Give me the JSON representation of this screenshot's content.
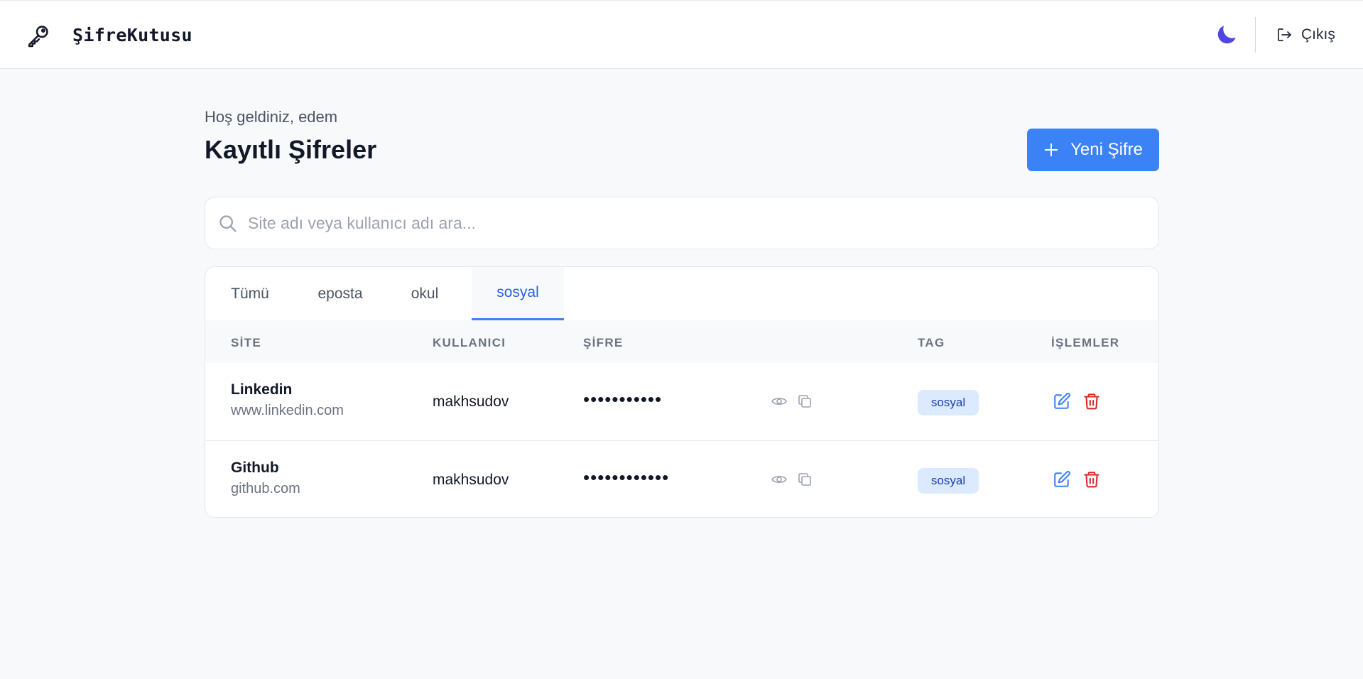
{
  "header": {
    "brand": "ŞifreKutusu",
    "logout_label": "Çıkış"
  },
  "page": {
    "welcome": "Hoş geldiniz, edem",
    "title": "Kayıtlı Şifreler",
    "new_button_label": "Yeni Şifre"
  },
  "search": {
    "placeholder": "Site adı veya kullanıcı adı ara...",
    "value": ""
  },
  "tabs": [
    {
      "label": "Tümü",
      "active": false
    },
    {
      "label": "eposta",
      "active": false
    },
    {
      "label": "okul",
      "active": false
    },
    {
      "label": "sosyal",
      "active": true
    }
  ],
  "table": {
    "headers": {
      "site": "SİTE",
      "user": "KULLANICI",
      "password": "ŞİFRE",
      "tag": "TAG",
      "actions": "İŞLEMLER"
    },
    "rows": [
      {
        "site": "Linkedin",
        "url": "www.linkedin.com",
        "username": "makhsudov",
        "password": "•••••••••••",
        "tag": "sosyal"
      },
      {
        "site": "Github",
        "url": "github.com",
        "username": "makhsudov",
        "password": "••••••••••••",
        "tag": "sosyal"
      }
    ]
  },
  "colors": {
    "accent": "#3b82f6",
    "theme_icon": "#4f46e5",
    "delete": "#dc2626",
    "tag_bg": "#dbeafe",
    "tag_text": "#1e40af"
  },
  "icons": {
    "brand": "key-icon",
    "theme": "moon-icon",
    "logout": "logout-icon",
    "add": "plus-icon",
    "search": "search-icon",
    "show": "eye-icon",
    "copy": "copy-icon",
    "edit": "edit-icon",
    "delete": "trash-icon"
  }
}
